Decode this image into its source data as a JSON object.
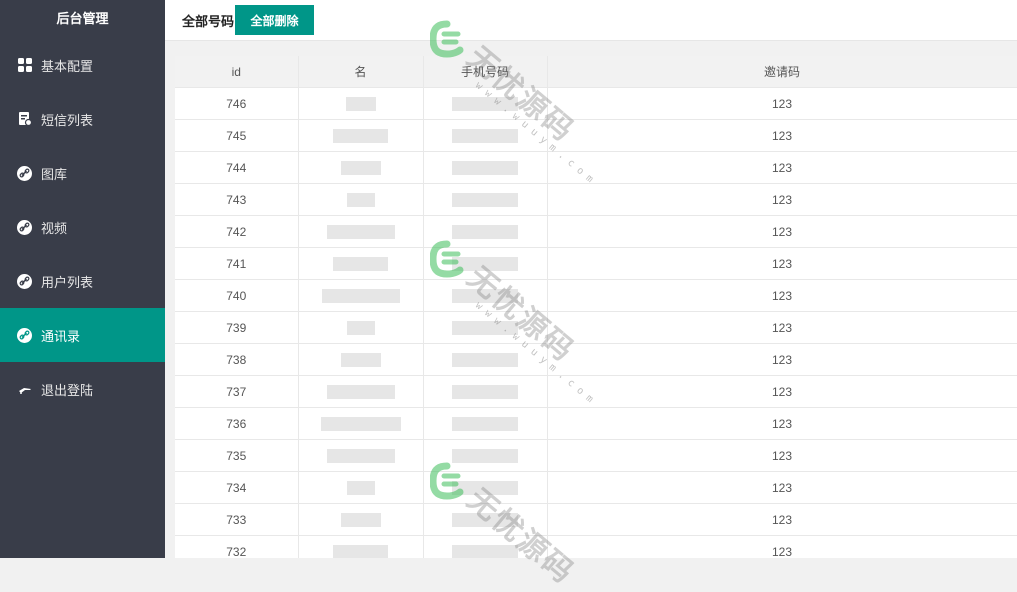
{
  "sidebar": {
    "brand": "后台管理",
    "items": [
      {
        "label": "基本配置",
        "icon": "grid-icon",
        "active": false
      },
      {
        "label": "短信列表",
        "icon": "sms-list-icon",
        "active": false
      },
      {
        "label": "图库",
        "icon": "link-icon",
        "active": false
      },
      {
        "label": "视频",
        "icon": "link-icon",
        "active": false
      },
      {
        "label": "用户列表",
        "icon": "link-icon",
        "active": false
      },
      {
        "label": "通讯录",
        "icon": "link-icon",
        "active": true
      },
      {
        "label": "退出登陆",
        "icon": "logout-icon",
        "active": false
      }
    ]
  },
  "topbar": {
    "title": "全部号码",
    "delete_all_label": "全部删除"
  },
  "table": {
    "headers": [
      "id",
      "名",
      "手机号码",
      "邀请码"
    ],
    "rows": [
      {
        "id": "746",
        "code": "123"
      },
      {
        "id": "745",
        "code": "123"
      },
      {
        "id": "744",
        "code": "123"
      },
      {
        "id": "743",
        "code": "123"
      },
      {
        "id": "742",
        "code": "123"
      },
      {
        "id": "741",
        "code": "123"
      },
      {
        "id": "740",
        "code": "123"
      },
      {
        "id": "739",
        "code": "123"
      },
      {
        "id": "738",
        "code": "123"
      },
      {
        "id": "737",
        "code": "123"
      },
      {
        "id": "736",
        "code": "123"
      },
      {
        "id": "735",
        "code": "123"
      },
      {
        "id": "734",
        "code": "123"
      },
      {
        "id": "733",
        "code": "123"
      },
      {
        "id": "732",
        "code": "123"
      }
    ]
  },
  "watermark": {
    "text": "无忧源码",
    "url": "www.wuuym.com"
  },
  "colors": {
    "sidebar_bg": "#393d49",
    "accent": "#009688"
  }
}
